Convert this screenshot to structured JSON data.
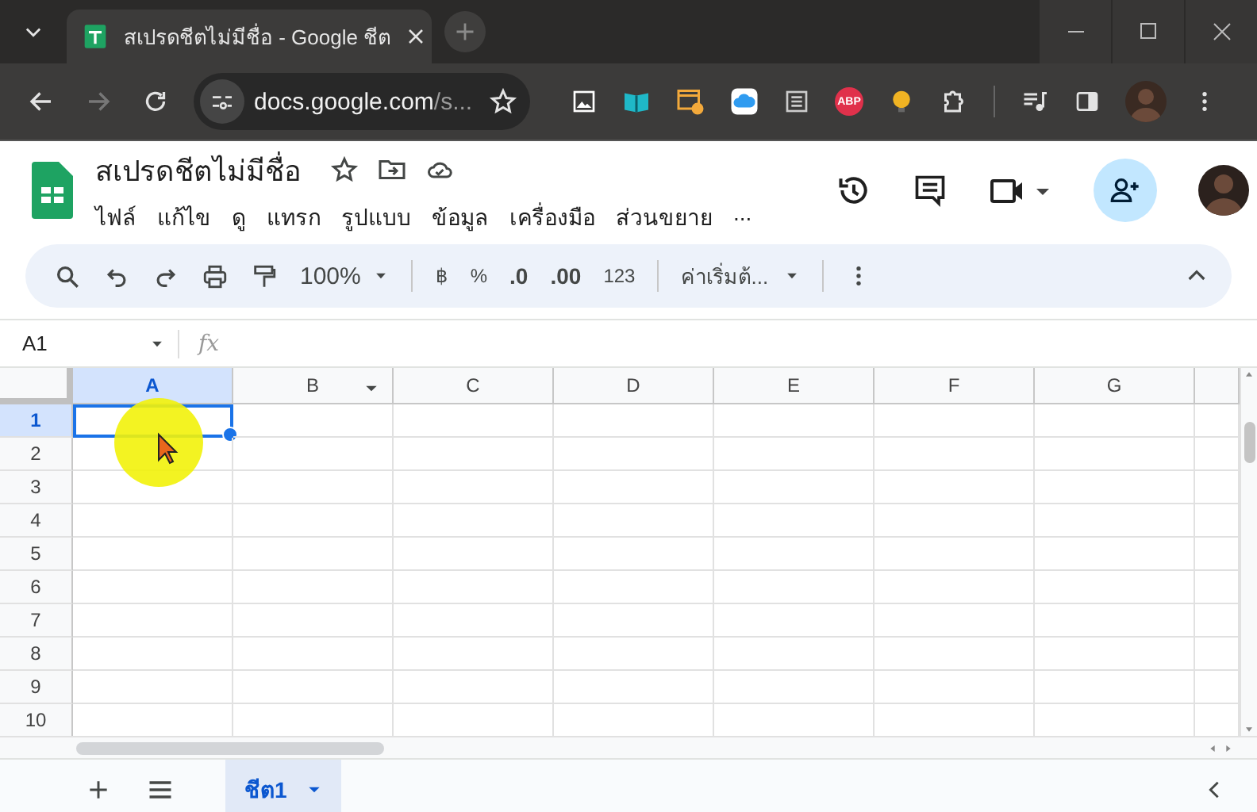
{
  "browser": {
    "tab": {
      "title": "สเปรดชีตไม่มีชื่อ - Google ชีต",
      "selected": true
    },
    "address": {
      "domain": "docs.google.com",
      "path": "/s..."
    },
    "abp_label": "ABP"
  },
  "header": {
    "title": "สเปรดชีตไม่มีชื่อ",
    "menu": [
      "ไฟล์",
      "แก้ไข",
      "ดู",
      "แทรก",
      "รูปแบบ",
      "ข้อมูล",
      "เครื่องมือ",
      "ส่วนขยาย"
    ],
    "menu_overflow": "..."
  },
  "toolbar": {
    "zoom": "100%",
    "currency": "฿",
    "percent": "%",
    "decrease_decimal": ".0",
    "increase_decimal": ".00",
    "number_format": "123",
    "font": "ค่าเริ่มต้..."
  },
  "formula_bar": {
    "name_box": "A1",
    "fx": "fx"
  },
  "grid": {
    "columns": [
      {
        "label": "A",
        "selected": true,
        "menu": false
      },
      {
        "label": "B",
        "selected": false,
        "menu": true
      },
      {
        "label": "C",
        "selected": false,
        "menu": false
      },
      {
        "label": "D",
        "selected": false,
        "menu": false
      },
      {
        "label": "E",
        "selected": false,
        "menu": false
      },
      {
        "label": "F",
        "selected": false,
        "menu": false
      },
      {
        "label": "G",
        "selected": false,
        "menu": false
      }
    ],
    "rows": [
      {
        "label": "1",
        "selected": true
      },
      {
        "label": "2",
        "selected": false
      },
      {
        "label": "3",
        "selected": false
      },
      {
        "label": "4",
        "selected": false
      },
      {
        "label": "5",
        "selected": false
      },
      {
        "label": "6",
        "selected": false
      },
      {
        "label": "7",
        "selected": false
      },
      {
        "label": "8",
        "selected": false
      },
      {
        "label": "9",
        "selected": false
      },
      {
        "label": "10",
        "selected": false
      }
    ]
  },
  "sheets": [
    {
      "name": "ชีต1",
      "selected": true
    }
  ]
}
